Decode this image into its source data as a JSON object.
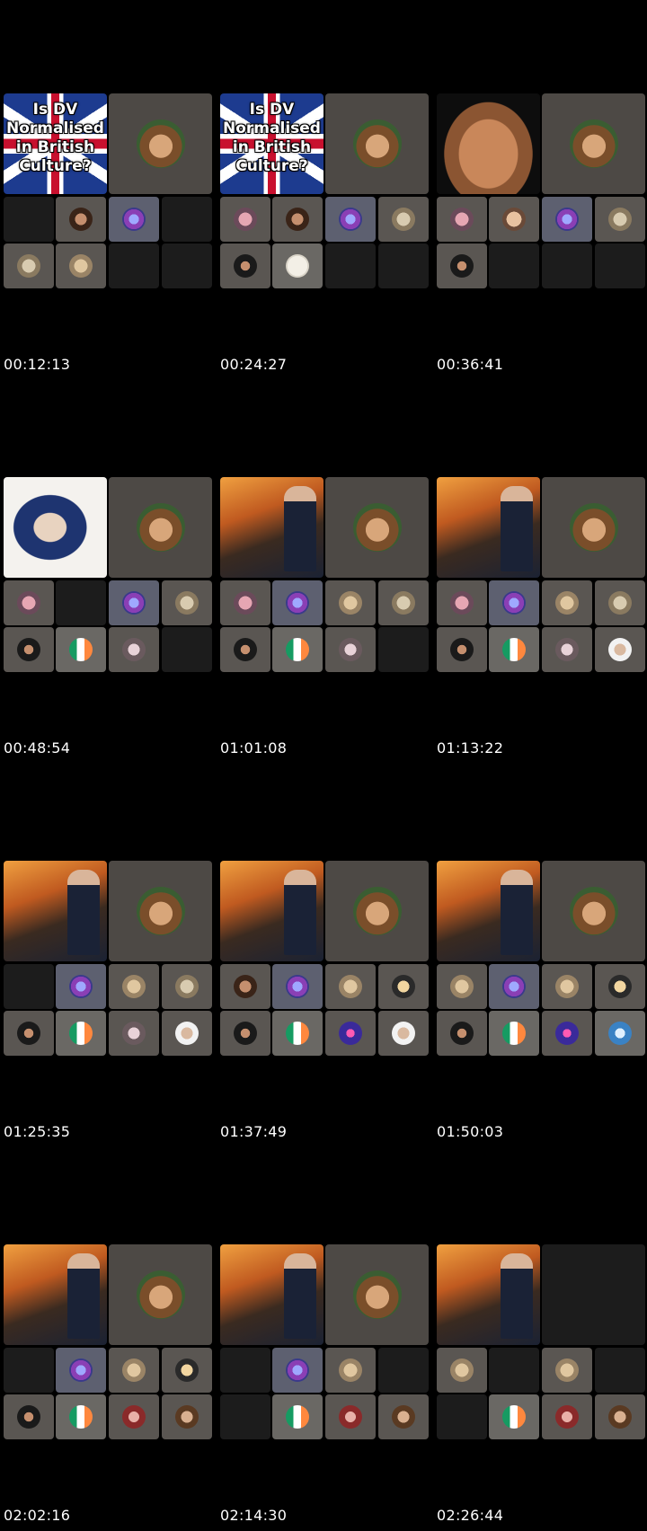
{
  "frames": [
    {
      "timestamp": "00:12:13",
      "thumbnail": "uk-flag-title",
      "thumbnail_text": [
        "Is DV",
        "Normalised",
        "in British",
        "Culture?"
      ],
      "row1": [
        "empty",
        "av-woman",
        "av-purple",
        "empty"
      ],
      "row2": [
        "av-sepia",
        "av-blonde",
        "empty",
        "empty"
      ]
    },
    {
      "timestamp": "00:24:27",
      "thumbnail": "uk-flag-title",
      "thumbnail_text": [
        "Is DV",
        "Normalised",
        "in British",
        "Culture?"
      ],
      "row1": [
        "av-pink",
        "av-woman",
        "av-purple",
        "av-sepia"
      ],
      "row2": [
        "av-dark",
        "av-logo",
        "empty",
        "empty"
      ]
    },
    {
      "timestamp": "00:36:41",
      "thumbnail": "bodies",
      "row1": [
        "av-pink",
        "av-bald",
        "av-purple",
        "av-sepia"
      ],
      "row2": [
        "av-dark",
        "empty",
        "empty",
        "empty"
      ]
    },
    {
      "timestamp": "00:48:54",
      "thumbnail": "uncle-sam",
      "row1": [
        "av-pink",
        "empty",
        "av-purple",
        "av-sepia"
      ],
      "row2": [
        "av-dark",
        "av-irish",
        "av-grey",
        "empty"
      ]
    },
    {
      "timestamp": "01:01:08",
      "thumbnail": "fire",
      "row1": [
        "av-pink",
        "av-purple",
        "av-blonde",
        "av-sepia"
      ],
      "row2": [
        "av-dark",
        "av-irish",
        "av-grey",
        "empty"
      ]
    },
    {
      "timestamp": "01:13:22",
      "thumbnail": "fire",
      "row1": [
        "av-pink",
        "av-purple",
        "av-blonde",
        "av-sepia"
      ],
      "row2": [
        "av-dark",
        "av-irish",
        "av-grey",
        "av-man"
      ]
    },
    {
      "timestamp": "01:25:35",
      "thumbnail": "fire",
      "row1": [
        "empty",
        "av-purple",
        "av-blonde",
        "av-sepia"
      ],
      "row2": [
        "av-dark",
        "av-irish",
        "av-grey",
        "av-man"
      ]
    },
    {
      "timestamp": "01:37:49",
      "thumbnail": "fire",
      "row1": [
        "av-woman",
        "av-purple",
        "av-blonde",
        "av-cat"
      ],
      "row2": [
        "av-dark",
        "av-irish",
        "av-spirit",
        "av-man"
      ]
    },
    {
      "timestamp": "01:50:03",
      "thumbnail": "fire",
      "row1": [
        "av-blonde",
        "av-purple",
        "av-blonde",
        "av-cat"
      ],
      "row2": [
        "av-dark",
        "av-irish",
        "av-spirit",
        "av-ghost"
      ]
    },
    {
      "timestamp": "02:02:16",
      "thumbnail": "fire",
      "row1": [
        "empty",
        "av-purple",
        "av-blonde",
        "av-cat"
      ],
      "row2": [
        "av-dark",
        "av-irish",
        "av-redhead",
        "av-tan"
      ]
    },
    {
      "timestamp": "02:14:30",
      "thumbnail": "fire",
      "row1": [
        "empty",
        "av-purple",
        "av-blonde",
        "empty"
      ],
      "row2": [
        "empty",
        "av-irish",
        "av-redhead",
        "av-tan"
      ]
    },
    {
      "timestamp": "02:26:44",
      "thumbnail": "fire",
      "host_visible": false,
      "row1": [
        "av-blonde",
        "empty",
        "av-blonde",
        "empty"
      ],
      "row2": [
        "empty",
        "av-irish",
        "av-redhead",
        "av-tan"
      ]
    }
  ],
  "host_avatar_icon": "bear-avatar-icon"
}
